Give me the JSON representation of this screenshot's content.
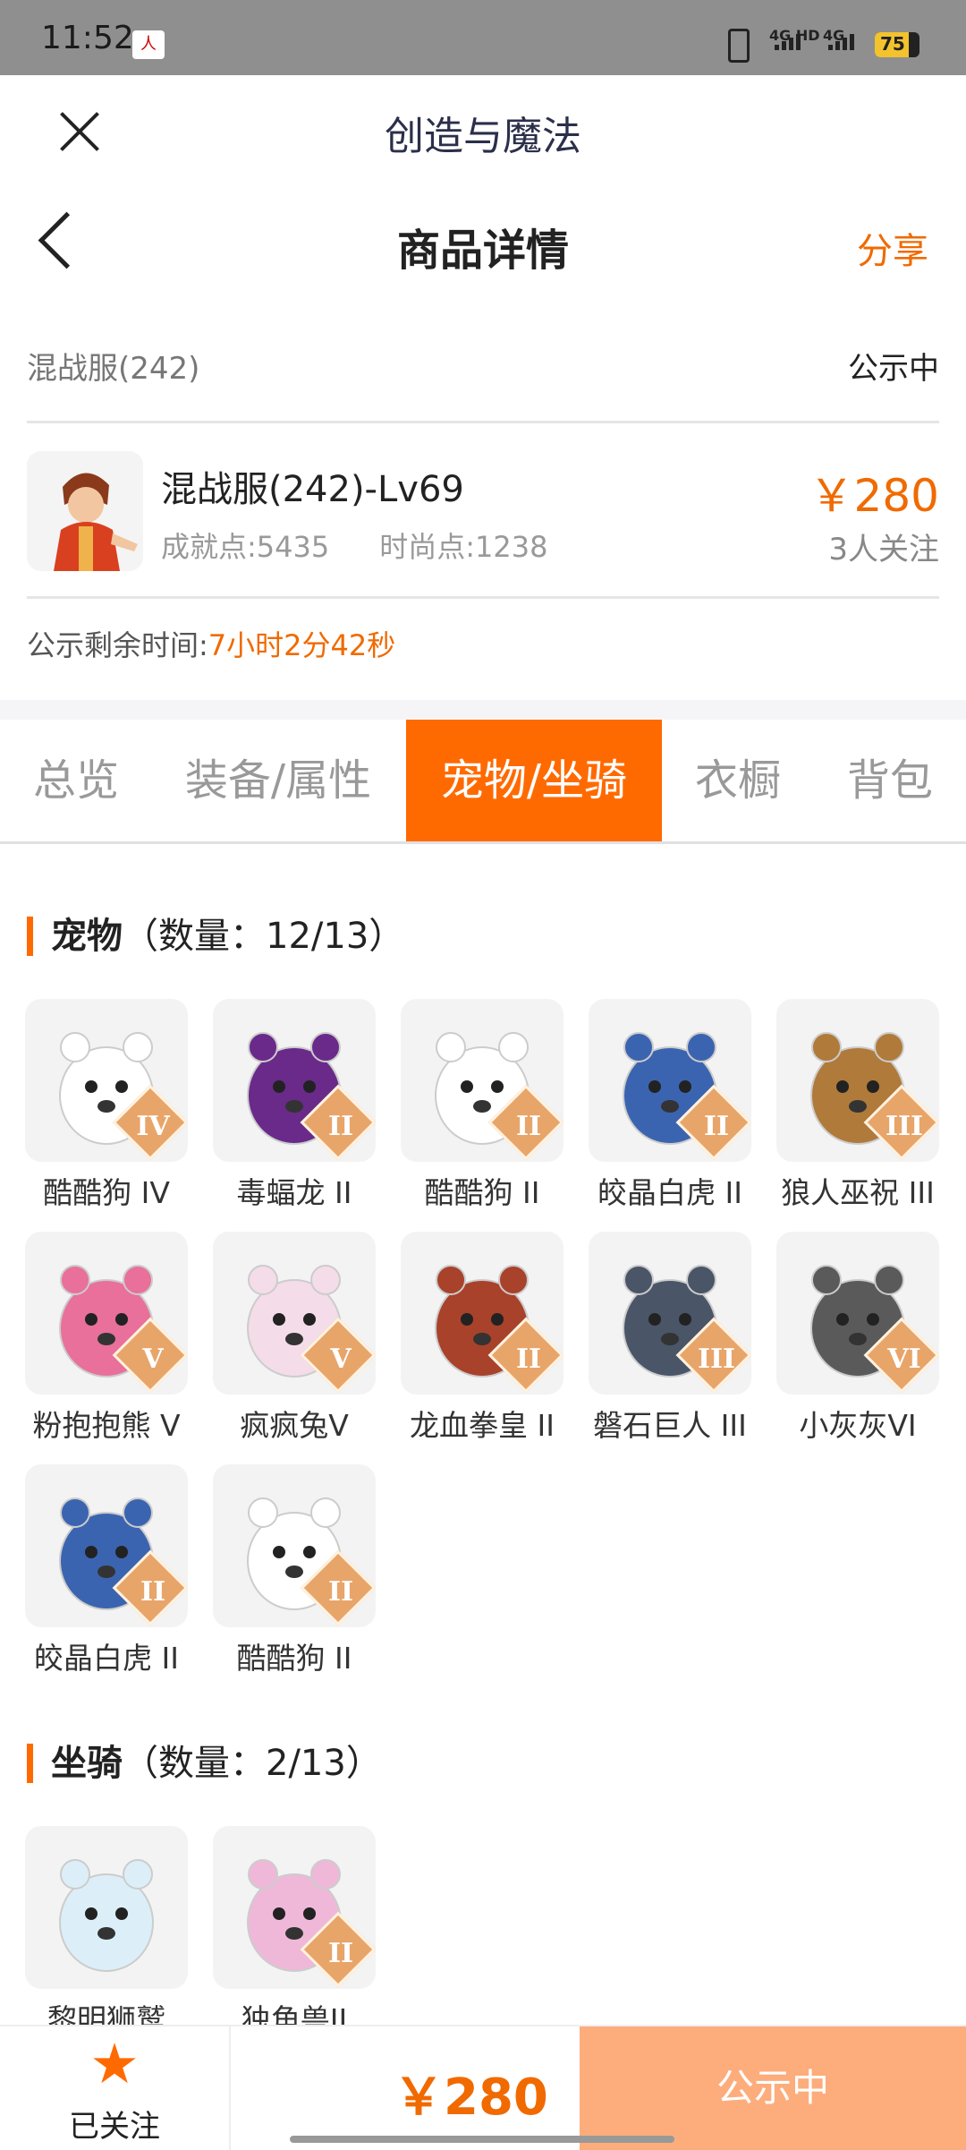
{
  "status_bar": {
    "time": "11:52",
    "app_icon_text": "人",
    "net1": "4G HD",
    "net2": "4G",
    "battery": "75"
  },
  "app": {
    "title": "创造与魔法"
  },
  "nav": {
    "title": "商品详情",
    "share": "分享"
  },
  "listing": {
    "server": "混战服(242)",
    "status": "公示中",
    "name": "混战服(242)-Lv69",
    "achievement": "成就点:5435",
    "fashion": "时尚点:1238",
    "price": "￥280",
    "watchers": "3人关注",
    "countdown_label": "公示剩余时间:",
    "countdown_value": "7小时2分42秒"
  },
  "tabs": [
    "总览",
    "装备/属性",
    "宠物/坐骑",
    "衣橱",
    "背包"
  ],
  "active_tab": 2,
  "pets": {
    "title": "宠物",
    "count": "（数量：12/13）",
    "items": [
      {
        "name": "酷酷狗 IV",
        "grade": "IV",
        "color": "#ffffff"
      },
      {
        "name": "毒蝠龙 II",
        "grade": "II",
        "color": "#6a2a8a"
      },
      {
        "name": "酷酷狗 II",
        "grade": "II",
        "color": "#ffffff"
      },
      {
        "name": "皎晶白虎 II",
        "grade": "II",
        "color": "#3b64b0"
      },
      {
        "name": "狼人巫祝 III",
        "grade": "III",
        "color": "#b07a3a"
      },
      {
        "name": "粉抱抱熊 V",
        "grade": "V",
        "color": "#e8709a"
      },
      {
        "name": "疯疯兔V",
        "grade": "V",
        "color": "#f4dce8"
      },
      {
        "name": "龙血拳皇 II",
        "grade": "II",
        "color": "#a8422a"
      },
      {
        "name": "磐石巨人 III",
        "grade": "III",
        "color": "#4a5568"
      },
      {
        "name": "小灰灰VI",
        "grade": "VI",
        "color": "#5a5a5a"
      },
      {
        "name": "皎晶白虎 II",
        "grade": "II",
        "color": "#3b64b0"
      },
      {
        "name": "酷酷狗 II",
        "grade": "II",
        "color": "#ffffff"
      }
    ]
  },
  "mounts": {
    "title": "坐骑",
    "count": "（数量：2/13）",
    "items": [
      {
        "name": "黎明狮鹫",
        "grade": "",
        "color": "#dceff8"
      },
      {
        "name": "独角兽II",
        "grade": "II",
        "color": "#f0b8d8"
      }
    ]
  },
  "bottom": {
    "follow_label": "已关注",
    "price": "￥280",
    "button": "公示中"
  }
}
